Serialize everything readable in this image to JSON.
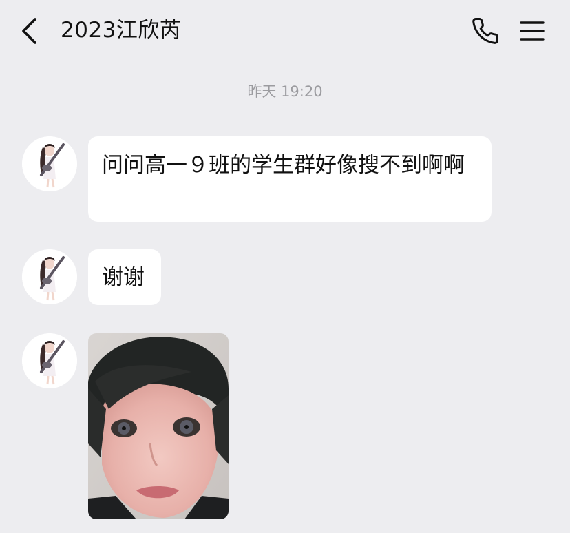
{
  "header": {
    "title": "2023江欣芮",
    "back_icon": "chevron-left-icon",
    "call_icon": "phone-icon",
    "menu_icon": "menu-icon"
  },
  "chat": {
    "timestamp": "昨天 19:20",
    "messages": [
      {
        "type": "text",
        "text": "问问高一９班的学生群好像搜不到啊啊"
      },
      {
        "type": "text",
        "text": "谢谢"
      },
      {
        "type": "image"
      }
    ]
  }
}
